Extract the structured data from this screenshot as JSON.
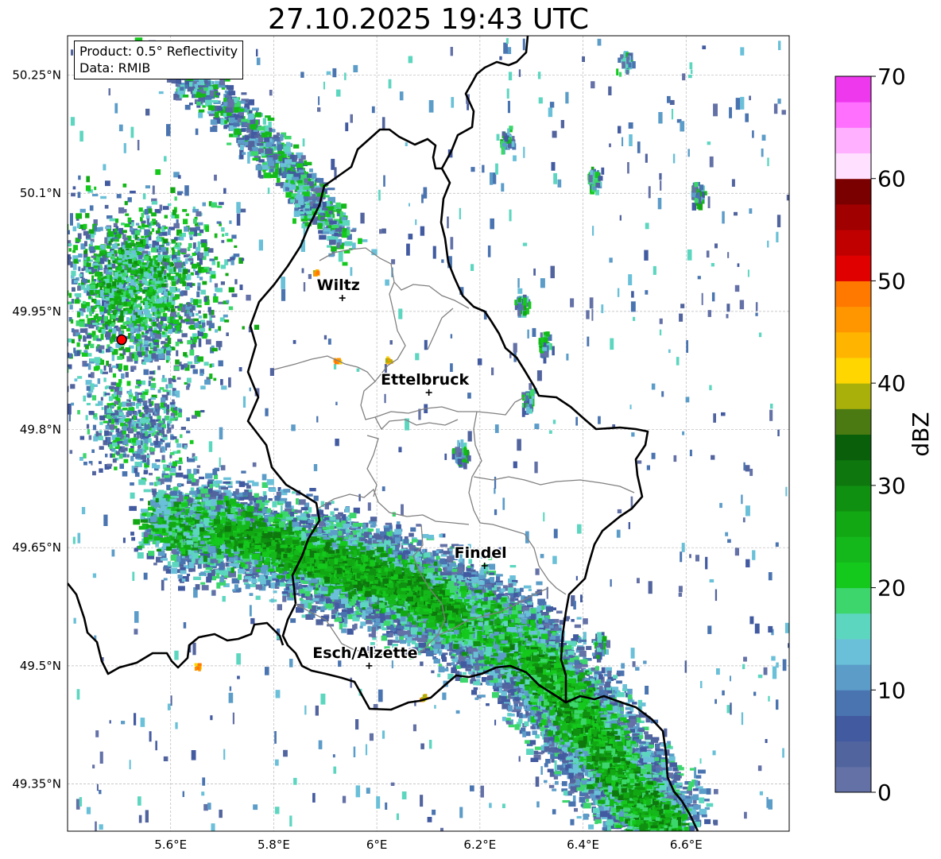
{
  "title": "27.10.2025 19:43 UTC",
  "info_box": {
    "product_line": "Product: 0.5° Reflectivity",
    "data_line": "Data: RMIB"
  },
  "map": {
    "extent": {
      "lon_min": 5.4,
      "lon_max": 6.8,
      "lat_min": 49.29,
      "lat_max": 50.3
    },
    "lon_ticks": [
      5.6,
      5.8,
      6.0,
      6.2,
      6.4,
      6.6
    ],
    "lon_tick_labels": [
      "5.6°E",
      "5.8°E",
      "6°E",
      "6.2°E",
      "6.4°E",
      "6.6°E"
    ],
    "lat_ticks": [
      50.25,
      50.1,
      49.95,
      49.8,
      49.65,
      49.5,
      49.35
    ],
    "lat_tick_labels": [
      "50.25°N",
      "50.1°N",
      "49.95°N",
      "49.8°N",
      "49.65°N",
      "49.5°N",
      "49.35°N"
    ],
    "gridlines": true,
    "radar_site": {
      "lon": 5.505,
      "lat": 49.914,
      "color": "#ff0000"
    },
    "cities": [
      {
        "name": "Wiltz",
        "lon": 5.933,
        "lat": 49.967
      },
      {
        "name": "Ettelbruck",
        "lon": 6.101,
        "lat": 49.847
      },
      {
        "name": "Findel",
        "lon": 6.209,
        "lat": 49.627
      },
      {
        "name": "Esch/Alzette",
        "lon": 5.985,
        "lat": 49.5
      }
    ],
    "echo_bands": [
      {
        "description": "main band",
        "path": [
          [
            5.58,
            49.685
          ],
          [
            5.72,
            49.67
          ],
          [
            5.87,
            49.64
          ],
          [
            5.97,
            49.62
          ],
          [
            6.06,
            49.6
          ],
          [
            6.14,
            49.57
          ],
          [
            6.22,
            49.55
          ],
          [
            6.3,
            49.51
          ],
          [
            6.37,
            49.45
          ],
          [
            6.43,
            49.4
          ],
          [
            6.49,
            49.34
          ],
          [
            6.56,
            49.29
          ]
        ]
      },
      {
        "description": "west cluster",
        "center": [
          5.5,
          49.96
        ]
      },
      {
        "description": "northwest band",
        "path": [
          [
            5.58,
            50.27
          ],
          [
            5.72,
            50.2
          ],
          [
            5.84,
            50.12
          ],
          [
            5.92,
            50.05
          ]
        ]
      }
    ]
  },
  "colorbar": {
    "label": "dBZ",
    "min": 0,
    "max": 70,
    "step": 2.5,
    "tick_values": [
      0,
      10,
      20,
      30,
      40,
      50,
      60,
      70
    ],
    "tick_labels": [
      "0",
      "10",
      "20",
      "30",
      "40",
      "50",
      "60",
      "70"
    ],
    "colors": [
      "#6371a6",
      "#52649e",
      "#425aa0",
      "#4a74b0",
      "#5b9cc8",
      "#69c0d8",
      "#5dd6c0",
      "#3cd66c",
      "#14c81c",
      "#14b81a",
      "#12a814",
      "#109010",
      "#0e780e",
      "#0a600a",
      "#4b7a12",
      "#aab00a",
      "#ffd600",
      "#ffb400",
      "#ff9600",
      "#ff7800",
      "#e00000",
      "#c00000",
      "#a00000",
      "#7a0000",
      "#ffe0ff",
      "#ffb0ff",
      "#ff70ff",
      "#ee38ee"
    ]
  }
}
